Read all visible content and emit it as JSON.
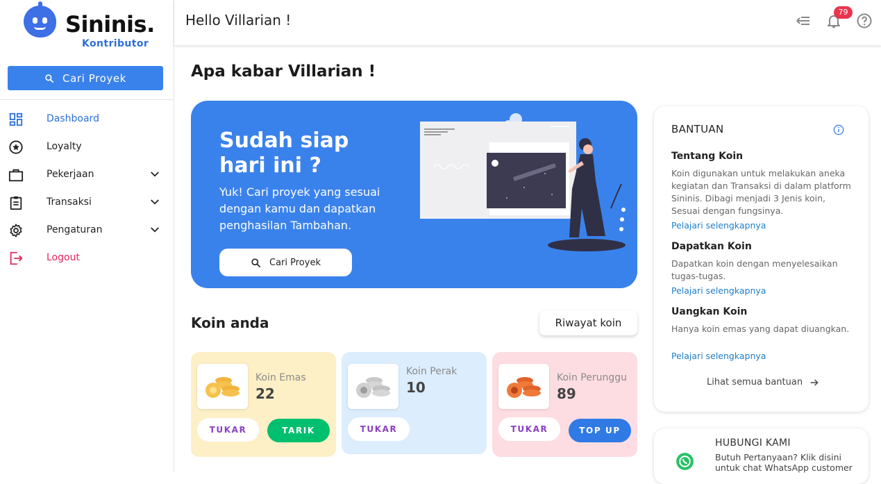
{
  "brand": {
    "name": "Sininis.",
    "role": "Kontributor"
  },
  "sidebar": {
    "search_label": "Cari Proyek",
    "items": [
      {
        "label": "Dashboard",
        "icon": "dashboard-icon"
      },
      {
        "label": "Loyalty",
        "icon": "star-circle-icon"
      },
      {
        "label": "Pekerjaan",
        "icon": "briefcase-icon"
      },
      {
        "label": "Transaksi",
        "icon": "clipboard-icon"
      },
      {
        "label": "Pengaturan",
        "icon": "gear-icon"
      },
      {
        "label": "Logout",
        "icon": "logout-icon"
      }
    ]
  },
  "topbar": {
    "greeting": "Hello Villarian !",
    "notification_count": "79"
  },
  "main": {
    "title": "Apa kabar Villarian !",
    "hero": {
      "heading": "Sudah siap hari ini ?",
      "text": "Yuk! Cari proyek yang sesuai dengan kamu dan dapatkan penghasilan Tambahan.",
      "button": "Cari Proyek"
    },
    "koin_title": "Koin anda",
    "riwayat_button": "Riwayat koin",
    "coins": [
      {
        "name": "Koin Emas",
        "value": "22",
        "tukar": "TUKAR",
        "action": "TARIK",
        "color": "#fdefc6"
      },
      {
        "name": "Koin Perak",
        "value": "10",
        "tukar": "TUKAR",
        "color": "#dcedfd"
      },
      {
        "name": "Koin Perunggu",
        "value": "89",
        "tukar": "TUKAR",
        "action": "TOP UP",
        "color": "#fddde2"
      }
    ]
  },
  "help": {
    "title": "BANTUAN",
    "sections": [
      {
        "title": "Tentang Koin",
        "text": "Koin digunakan untuk melakukan aneka kegiatan dan Transaksi di dalam platform Sininis. Dibagi menjadi 3 Jenis koin, Sesuai dengan fungsinya.",
        "link": "Pelajari selengkapnya"
      },
      {
        "title": "Dapatkan Koin",
        "text": "Dapatkan koin dengan menyelesaikan tugas-tugas.",
        "link": "Pelajari selengkapnya"
      },
      {
        "title": "Uangkan Koin",
        "text": "Hanya koin emas yang dapat diuangkan.",
        "link": "Pelajari selengkapnya"
      }
    ],
    "see_all": "Lihat semua bantuan"
  },
  "contact": {
    "title": "HUBUNGI KAMI",
    "text": "Butuh Pertanyaan? Klik disini untuk chat WhatsApp customer"
  }
}
